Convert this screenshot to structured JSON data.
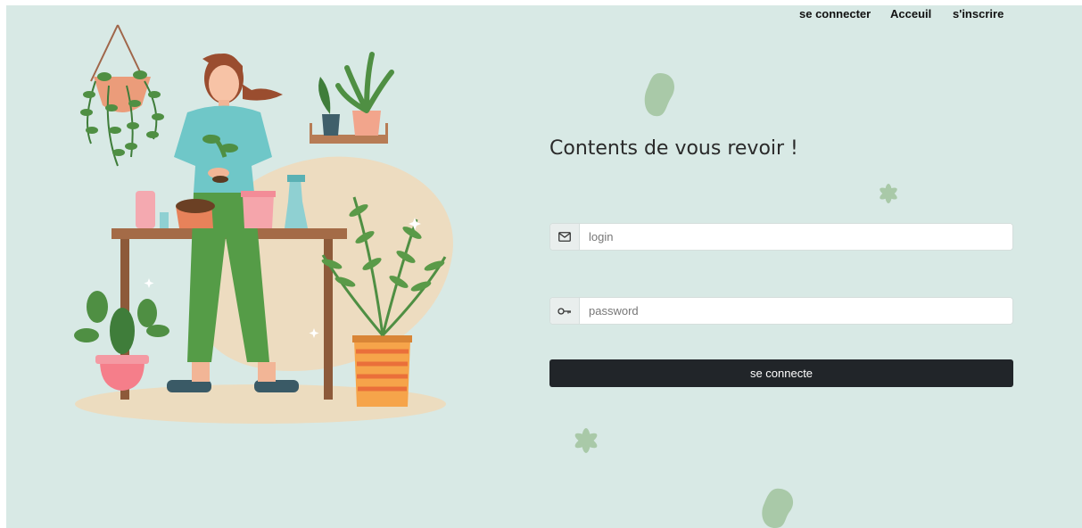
{
  "nav": {
    "login_label": "se connecter",
    "home_label": "Acceuil",
    "signup_label": "s'inscrire"
  },
  "form": {
    "title": "Contents de vous revoir !",
    "login_placeholder": "login",
    "password_placeholder": "password",
    "submit_label": "se connecte"
  },
  "icons": {
    "login_icon": "envelope-icon",
    "password_icon": "key-icon"
  },
  "colors": {
    "background": "#d8e9e5",
    "button": "#212529",
    "leaf_green": "#5a9a48",
    "deco_green": "#a9c9a8"
  }
}
